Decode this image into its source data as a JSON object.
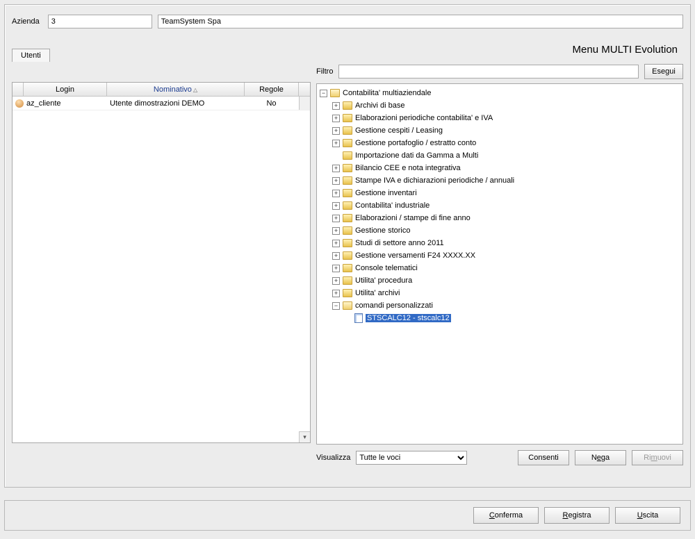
{
  "header": {
    "azienda_label": "Azienda",
    "azienda_code": "3",
    "azienda_name": "TeamSystem Spa"
  },
  "title": "Menu MULTI Evolution",
  "tabs": {
    "utenti": "Utenti"
  },
  "filter": {
    "label": "Filtro",
    "value": "",
    "button": "Esegui"
  },
  "grid": {
    "col_login": "Login",
    "col_nominativo": "Nominativo",
    "col_regole": "Regole",
    "rows": [
      {
        "login": "az_cliente",
        "nominativo": "Utente dimostrazioni DEMO",
        "regole": "No"
      }
    ]
  },
  "tree": {
    "root": "Contabilita' multiaziendale",
    "items": [
      {
        "label": "Archivi di base",
        "exp": "+"
      },
      {
        "label": "Elaborazioni periodiche contabilita' e IVA",
        "exp": "+"
      },
      {
        "label": "Gestione cespiti / Leasing",
        "exp": "+"
      },
      {
        "label": "Gestione portafoglio / estratto conto",
        "exp": "+"
      },
      {
        "label": "Importazione dati da Gamma a Multi",
        "exp": ""
      },
      {
        "label": "Bilancio CEE e nota integrativa",
        "exp": "+"
      },
      {
        "label": "Stampe IVA e dichiarazioni periodiche / annuali",
        "exp": "+"
      },
      {
        "label": "Gestione inventari",
        "exp": "+"
      },
      {
        "label": "Contabilita' industriale",
        "exp": "+"
      },
      {
        "label": "Elaborazioni / stampe di fine anno",
        "exp": "+"
      },
      {
        "label": "Gestione storico",
        "exp": "+"
      },
      {
        "label": "Studi di settore anno 2011",
        "exp": "+"
      },
      {
        "label": "Gestione versamenti F24 XXXX.XX",
        "exp": "+"
      },
      {
        "label": "Console telematici",
        "exp": "+"
      },
      {
        "label": "Utilita' procedura",
        "exp": "+"
      },
      {
        "label": "Utilita' archivi",
        "exp": "+"
      }
    ],
    "custom_label": "comandi personalizzati",
    "custom_child": "STSCALC12 - stscalc12"
  },
  "visualizza": {
    "label": "Visualizza",
    "selected": "Tutte le voci",
    "consenti": "Consenti",
    "nega_pre": "N",
    "nega_u": "e",
    "nega_post": "ga",
    "rimuovi_pre": "Ri",
    "rimuovi_u": "m",
    "rimuovi_post": "uovi"
  },
  "footer": {
    "conferma_pre": "",
    "conferma_u": "C",
    "conferma_post": "onferma",
    "registra_pre": "",
    "registra_u": "R",
    "registra_post": "egistra",
    "uscita_pre": "",
    "uscita_u": "U",
    "uscita_post": "scita"
  }
}
